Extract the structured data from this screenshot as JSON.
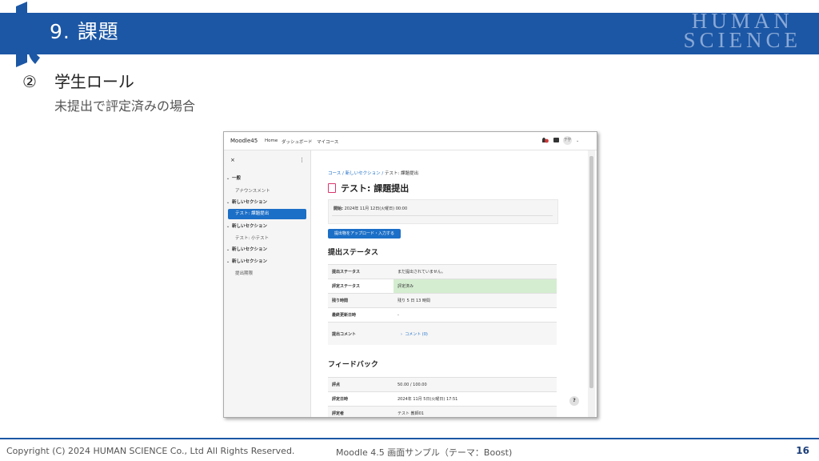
{
  "slide": {
    "title": "9. 課題",
    "brand_line1": "HUMAN",
    "brand_line2": "SCIENCE",
    "subheading_num": "②",
    "subheading": "学生ロール",
    "subdesc": "未提出で評定済みの場合",
    "footer_left": "Copyright (C) 2024 HUMAN SCIENCE Co., Ltd All Rights Reserved.",
    "footer_mid": "Moodle 4.5 画面サンプル（テーマ：Boost)",
    "page_number": "16"
  },
  "moodle": {
    "site_name": "Moodle45",
    "nav": [
      "Home",
      "ダッシュボード",
      "マイコース"
    ],
    "notification_badge": "8",
    "avatar_initials": "テ学",
    "drawer": {
      "close": "×",
      "menu": "⋮",
      "items": [
        {
          "label": "一般",
          "kind": "section"
        },
        {
          "label": "アナウンスメント",
          "kind": "activity"
        },
        {
          "label": "新しいセクション",
          "kind": "section"
        },
        {
          "label": "テスト: 課題提出",
          "kind": "active"
        },
        {
          "label": "新しいセクション",
          "kind": "section"
        },
        {
          "label": "テスト: 小テスト",
          "kind": "activity"
        },
        {
          "label": "新しいセクション",
          "kind": "section"
        },
        {
          "label": "新しいセクション",
          "kind": "section"
        },
        {
          "label": "提出期限",
          "kind": "activity"
        }
      ]
    },
    "breadcrumb": [
      "コース",
      "新しいセクション",
      "テスト: 課題提出"
    ],
    "page_title": "テスト: 課題提出",
    "opened_label": "開始:",
    "opened_value": "2024年 11月 12日(火曜日) 00:00",
    "submit_button": "提出物をアップロード・入力する",
    "status_heading": "提出ステータス",
    "status_rows": [
      {
        "k": "提出ステータス",
        "v": "まだ提出されていません。"
      },
      {
        "k": "評定ステータス",
        "v": "評定済み"
      },
      {
        "k": "残り時間",
        "v": "残り 5 日 13 時間"
      },
      {
        "k": "最終更新日時",
        "v": "-"
      },
      {
        "k": "提出コメント",
        "v": "コメント (0)"
      }
    ],
    "feedback_heading": "フィードバック",
    "feedback_rows": [
      {
        "k": "評点",
        "v": "50.00 / 100.00"
      },
      {
        "k": "評定日時",
        "v": "2024年 11月 5日(火曜日) 17:51"
      },
      {
        "k": "評定者",
        "v": "テスト 教師01"
      }
    ],
    "help": "?"
  },
  "colors": {
    "brand_blue": "#1c57a5",
    "moodle_blue": "#1c6fc7",
    "graded_green": "#d4edd0"
  }
}
